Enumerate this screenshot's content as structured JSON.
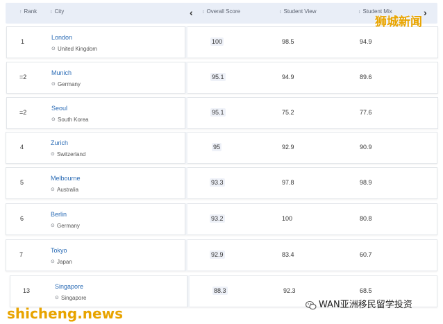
{
  "header": {
    "rank_label": "Rank",
    "city_label": "City",
    "overall_label": "Overall Score",
    "view_label": "Student View",
    "mix_label": "Student Mix",
    "sort_icon": "sort-arrow-icon",
    "prev_icon": "chevron-left-icon",
    "next_icon": "chevron-right-icon"
  },
  "rows": [
    {
      "rank": "1",
      "city": "London",
      "country": "United Kingdom",
      "overall": "100",
      "view": "98.5",
      "mix": "94.9"
    },
    {
      "rank": "=2",
      "city": "Munich",
      "country": "Germany",
      "overall": "95.1",
      "view": "94.9",
      "mix": "89.6"
    },
    {
      "rank": "=2",
      "city": "Seoul",
      "country": "South Korea",
      "overall": "95.1",
      "view": "75.2",
      "mix": "77.6"
    },
    {
      "rank": "4",
      "city": "Zurich",
      "country": "Switzerland",
      "overall": "95",
      "view": "92.9",
      "mix": "90.9"
    },
    {
      "rank": "5",
      "city": "Melbourne",
      "country": "Australia",
      "overall": "93.3",
      "view": "97.8",
      "mix": "98.9"
    },
    {
      "rank": "6",
      "city": "Berlin",
      "country": "Germany",
      "overall": "93.2",
      "view": "100",
      "mix": "80.8"
    },
    {
      "rank": "7",
      "city": "Tokyo",
      "country": "Japan",
      "overall": "92.9",
      "view": "83.4",
      "mix": "60.7"
    },
    {
      "rank": "13",
      "city": "Singapore",
      "country": "Singapore",
      "overall": "88.3",
      "view": "92.3",
      "mix": "68.5"
    }
  ],
  "watermarks": {
    "top_right": "狮城新闻",
    "bottom_left": "shicheng.news",
    "bottom_right": "WAN亚洲移民留学投资"
  },
  "colors": {
    "header_bg": "#e9eef7",
    "city_link": "#2a6bb5",
    "watermark": "#e8a400"
  }
}
